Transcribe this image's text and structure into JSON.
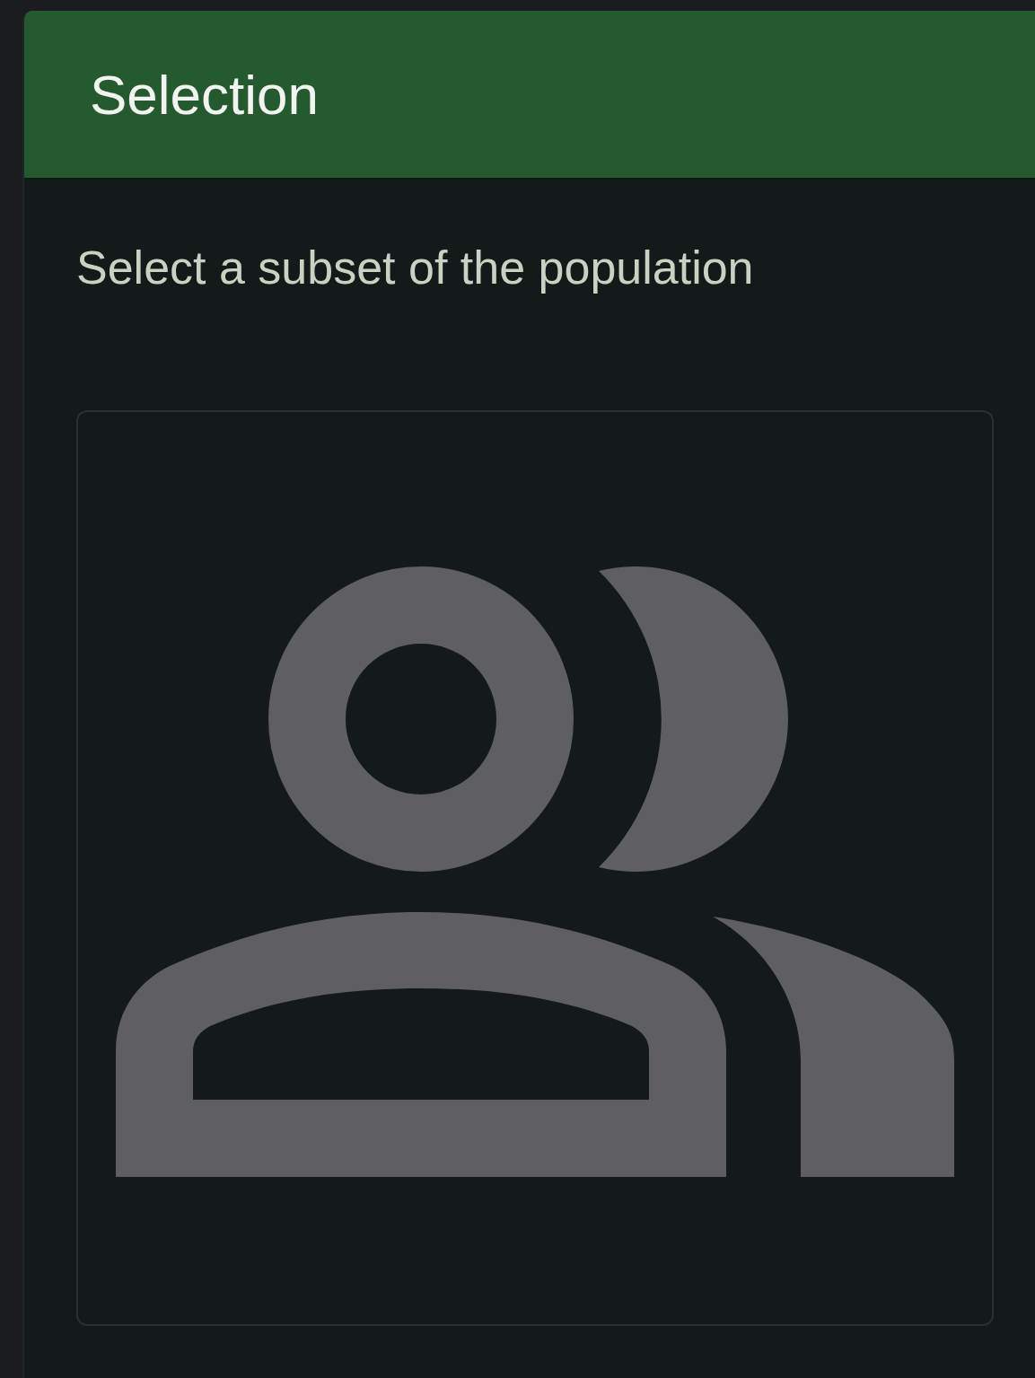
{
  "panel": {
    "title": "Selection",
    "description": "Select a subset of the population"
  }
}
